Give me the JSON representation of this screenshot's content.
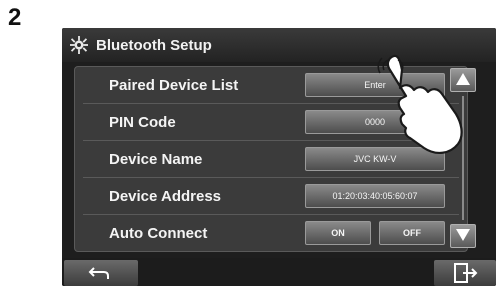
{
  "step_number": "2",
  "header": {
    "title": "Bluetooth Setup",
    "icon": "gear-icon"
  },
  "rows": [
    {
      "label": "Paired Device List",
      "value": "Enter"
    },
    {
      "label": "PIN Code",
      "value": "0000"
    },
    {
      "label": "Device Name",
      "value": "JVC KW-V"
    },
    {
      "label": "Device Address",
      "value": "01:20:03:40:05:60:07"
    },
    {
      "label": "Auto Connect",
      "on_label": "ON",
      "off_label": "OFF"
    }
  ],
  "scroll": {
    "up_icon": "triangle-up-icon",
    "down_icon": "triangle-down-icon"
  },
  "footer": {
    "back_icon": "back-arrow-icon",
    "exit_icon": "exit-icon"
  },
  "colors": {
    "screen_bg": "#1e1e1e",
    "panel_bg": "#3b3b3b",
    "button_grad_top": "#8a8a8a",
    "button_grad_bottom": "#4d4d4d"
  }
}
